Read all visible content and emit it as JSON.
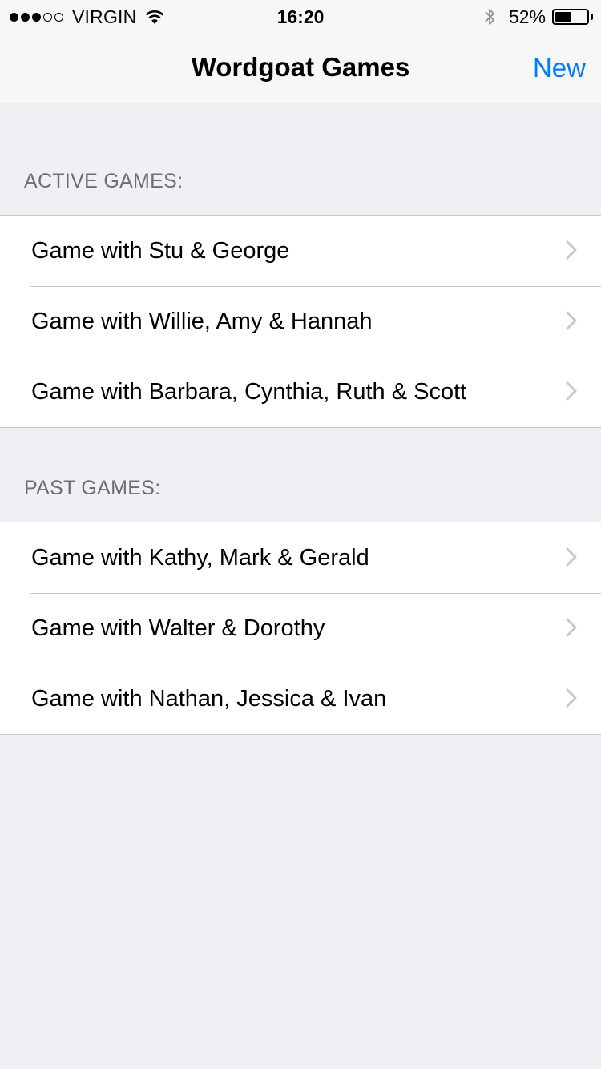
{
  "status_bar": {
    "carrier": "VIRGIN",
    "signal_bars_filled": 3,
    "signal_bars_total": 5,
    "time": "16:20",
    "battery_percent": "52%",
    "battery_level": 0.52,
    "icons": [
      "signal-dots-icon",
      "wifi-icon",
      "bluetooth-icon",
      "battery-icon"
    ]
  },
  "nav": {
    "title": "Wordgoat Games",
    "right_button": "New",
    "accent_color": "#007aff"
  },
  "sections": {
    "active": {
      "header": "ACTIVE GAMES:",
      "items": [
        {
          "label": "Game with Stu & George"
        },
        {
          "label": "Game with Willie, Amy & Hannah"
        },
        {
          "label": "Game with Barbara, Cynthia, Ruth & Scott"
        }
      ]
    },
    "past": {
      "header": "PAST GAMES:",
      "items": [
        {
          "label": "Game with Kathy, Mark & Gerald"
        },
        {
          "label": "Game with Walter & Dorothy"
        },
        {
          "label": "Game with Nathan, Jessica & Ivan"
        }
      ]
    }
  }
}
